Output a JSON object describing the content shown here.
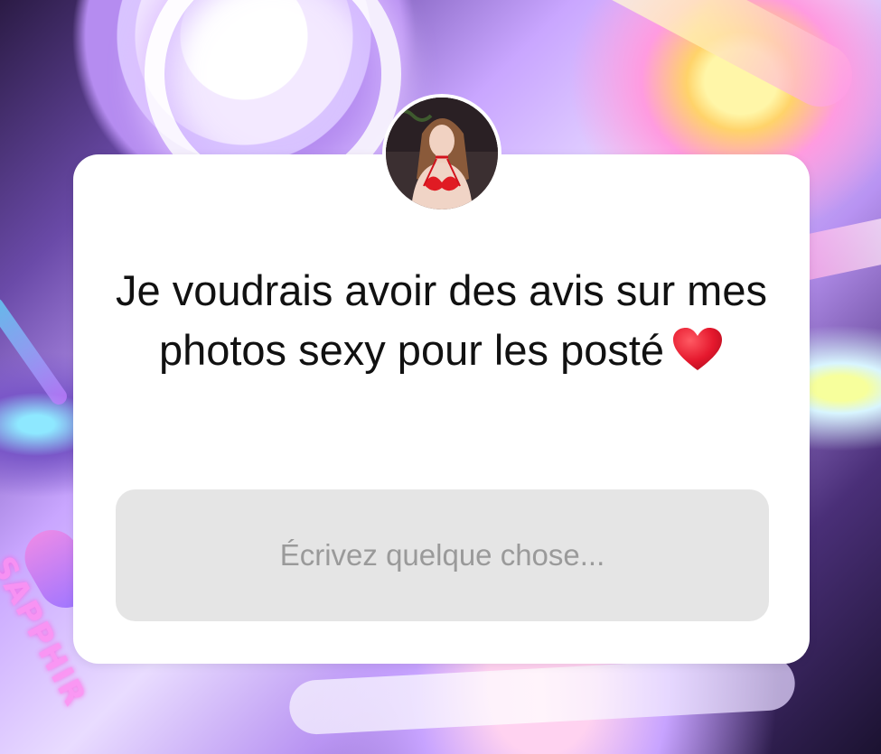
{
  "question_sticker": {
    "question_text": "Je voudrais avoir des avis sur mes photos sexy pour les posté",
    "emoji": "heart-emoji",
    "answer_placeholder": "Écrivez quelque chose..."
  },
  "background": {
    "brand_text": "SAPPHIR"
  },
  "colors": {
    "card_background": "#ffffff",
    "answer_field_background": "#e5e5e5",
    "placeholder_text": "#9a9a9a",
    "question_text": "#111111",
    "heart": "#e5182d"
  }
}
